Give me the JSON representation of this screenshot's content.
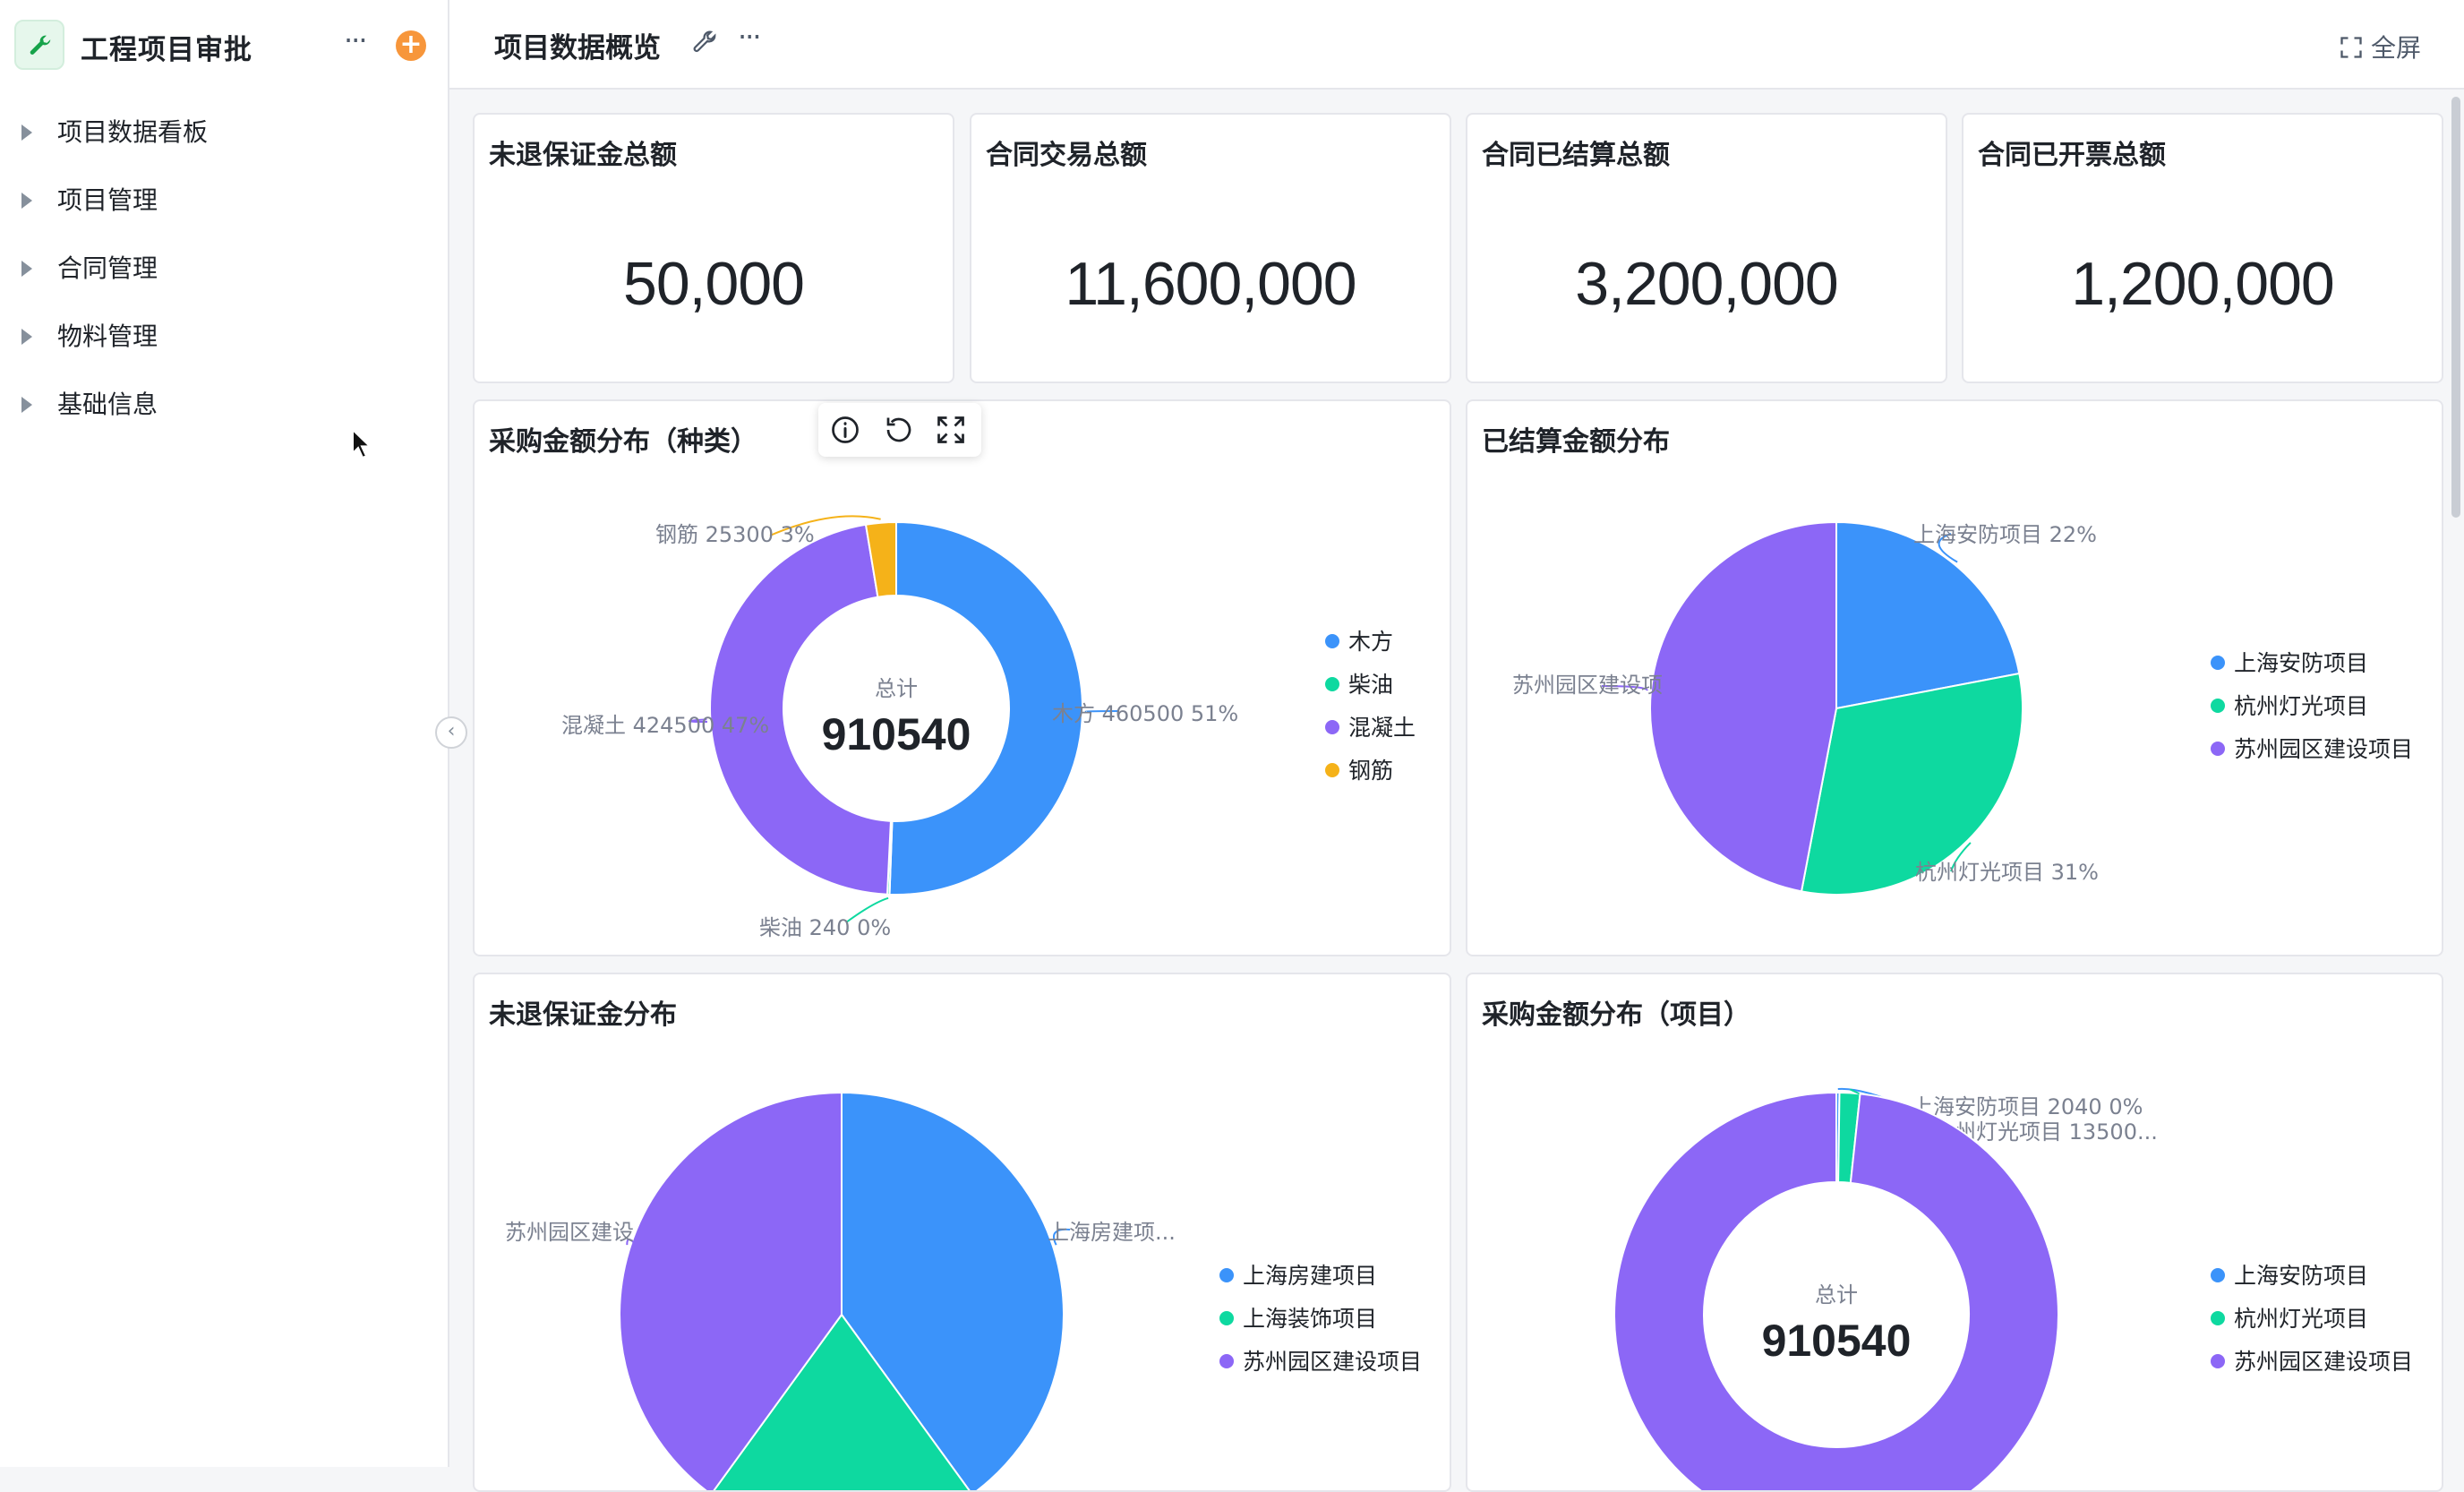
{
  "app": {
    "title": "工程项目审批",
    "more": "···",
    "add": "+"
  },
  "sidebar": {
    "items": [
      {
        "label": "项目数据看板"
      },
      {
        "label": "项目管理"
      },
      {
        "label": "合同管理"
      },
      {
        "label": "物料管理"
      },
      {
        "label": "基础信息"
      }
    ]
  },
  "topbar": {
    "title": "项目数据概览",
    "more": "···",
    "fullscreen": "全屏"
  },
  "stats": [
    {
      "title": "未退保证金总额",
      "value": "50,000"
    },
    {
      "title": "合同交易总额",
      "value": "11,600,000"
    },
    {
      "title": "合同已结算总额",
      "value": "3,200,000"
    },
    {
      "title": "合同已开票总额",
      "value": "1,200,000"
    }
  ],
  "colors": {
    "blue": "#3b93fa",
    "green": "#0ed9a0",
    "purple": "#8c67f6",
    "orange": "#f5b219"
  },
  "chart_data": [
    {
      "type": "pie",
      "variant": "donut",
      "title": "采购金额分布（种类）",
      "center_label": "总计",
      "center_value": "910540",
      "legend_position": "right",
      "slices": [
        {
          "name": "木方",
          "value": 460500,
          "label": "木方 460500 51%",
          "color": "#3b93fa"
        },
        {
          "name": "柴油",
          "value": 240,
          "label": "柴油 240 0%",
          "color": "#0ed9a0"
        },
        {
          "name": "混凝土",
          "value": 424500,
          "label": "混凝土 424500 47%",
          "color": "#8c67f6"
        },
        {
          "name": "钢筋",
          "value": 25300,
          "label": "钢筋 25300 3%",
          "color": "#f5b219"
        }
      ]
    },
    {
      "type": "pie",
      "title": "已结算金额分布",
      "legend_position": "right",
      "slices": [
        {
          "name": "上海安防项目",
          "value": 22,
          "label": "上海安防项目 22%",
          "color": "#3b93fa"
        },
        {
          "name": "杭州灯光项目",
          "value": 31,
          "label": "杭州灯光项目 31%",
          "color": "#0ed9a0"
        },
        {
          "name": "苏州园区建设项目",
          "value": 47,
          "label": "苏州园区建设项",
          "color": "#8c67f6"
        }
      ]
    },
    {
      "type": "pie",
      "title": "未退保证金分布",
      "legend_position": "right",
      "slices": [
        {
          "name": "上海房建项目",
          "value": 40,
          "label": "上海房建项...",
          "color": "#3b93fa"
        },
        {
          "name": "上海装饰项目",
          "value": 20,
          "label": "",
          "color": "#0ed9a0"
        },
        {
          "name": "苏州园区建设项目",
          "value": 40,
          "label": "苏州园区建设",
          "color": "#8c67f6"
        }
      ]
    },
    {
      "type": "pie",
      "variant": "donut",
      "title": "采购金额分布（项目）",
      "center_label": "总计",
      "center_value": "910540",
      "legend_position": "right",
      "slices": [
        {
          "name": "上海安防项目",
          "value": 2040,
          "label": "上海安防项目 2040 0%",
          "color": "#3b93fa"
        },
        {
          "name": "杭州灯光项目",
          "value": 13500,
          "label": "杭州灯光项目 13500...",
          "color": "#0ed9a0"
        },
        {
          "name": "苏州园区建设项目",
          "value": 895000,
          "label": "",
          "color": "#8c67f6"
        }
      ]
    }
  ]
}
